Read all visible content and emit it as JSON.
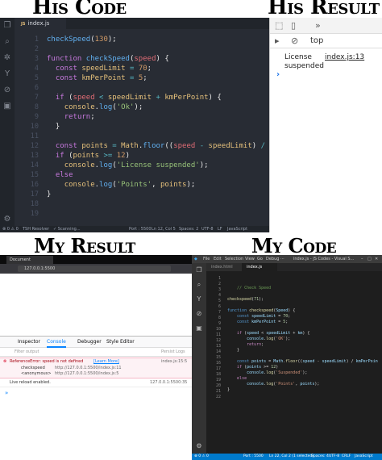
{
  "titles": {
    "his_code": "His Code",
    "his_result": "His Result",
    "my_result": "My Result",
    "my_code": "My Code"
  },
  "his_code": {
    "tab": "index.js",
    "line_numbers": [
      "1",
      "2",
      "3",
      "4",
      "5",
      "6",
      "7",
      "8",
      "9",
      "10",
      "11",
      "12",
      "13",
      "14",
      "15",
      "16",
      "17",
      "18",
      "19"
    ],
    "status": {
      "left": "⊗ 0 ⚠ 0",
      "tsb": "TSH Resolver",
      "scanning": "✓ Scanning...",
      "port": "Port : 5500",
      "position": "Ln 12, Col 5",
      "spaces": "Spaces: 2",
      "encoding": "UTF-8",
      "eol": "LF",
      "language": "JavaScript"
    }
  },
  "his_result": {
    "top_label": "top",
    "message": "License suspended",
    "source": "index.js:13",
    "prompt": "›"
  },
  "my_result": {
    "tab_title": "Document",
    "url": "127.0.0.1:5500",
    "devtools_tabs": [
      "Inspector",
      "Console",
      "Debugger",
      "Style Editor"
    ],
    "filter_placeholder": "Filter output",
    "persist_logs": "Persist Logs",
    "error_message": "ReferenceError: speed is not defined",
    "learn_more": "[Learn More]",
    "error_source": "index.js:15:5",
    "stack1": "checkspeed",
    "stack1_src": "http://127.0.0.1:5500/index.js:11",
    "stack2": "<anonymous>",
    "stack2_src": "http://127.0.0.1:5500/index.js:5",
    "info_message": "Live reload enabled.",
    "info_source": "127.0.0.1:5500:35",
    "prompt": "»"
  },
  "my_code": {
    "menu": [
      "File",
      "Edit",
      "Selection",
      "View",
      "Go",
      "Debug",
      "···"
    ],
    "window_title": "index.js - JS Codes - Visual S...",
    "tabs": [
      "index.html",
      "index.js"
    ],
    "line_numbers": [
      "1",
      "2",
      "3",
      "4",
      "5",
      "6",
      "7",
      "8",
      "9",
      "10",
      "11",
      "12",
      "13",
      "14",
      "15",
      "16",
      "17",
      "18",
      "19",
      "20",
      "21",
      "22"
    ],
    "status": {
      "branch": "⊗ 0 ⚠ 0",
      "port": "Port : 5500",
      "position": "Ln 22, Col 2 (1 selected)",
      "spaces": "Spaces: 4",
      "encoding": "UTF-8",
      "eol": "CRLF",
      "language": "JavaScript"
    }
  },
  "colors": {
    "his_editor_bg": "#282c34",
    "my_editor_bg": "#1e1e1e",
    "status_blue": "#007acc",
    "error_bg": "#fdf2f5"
  }
}
